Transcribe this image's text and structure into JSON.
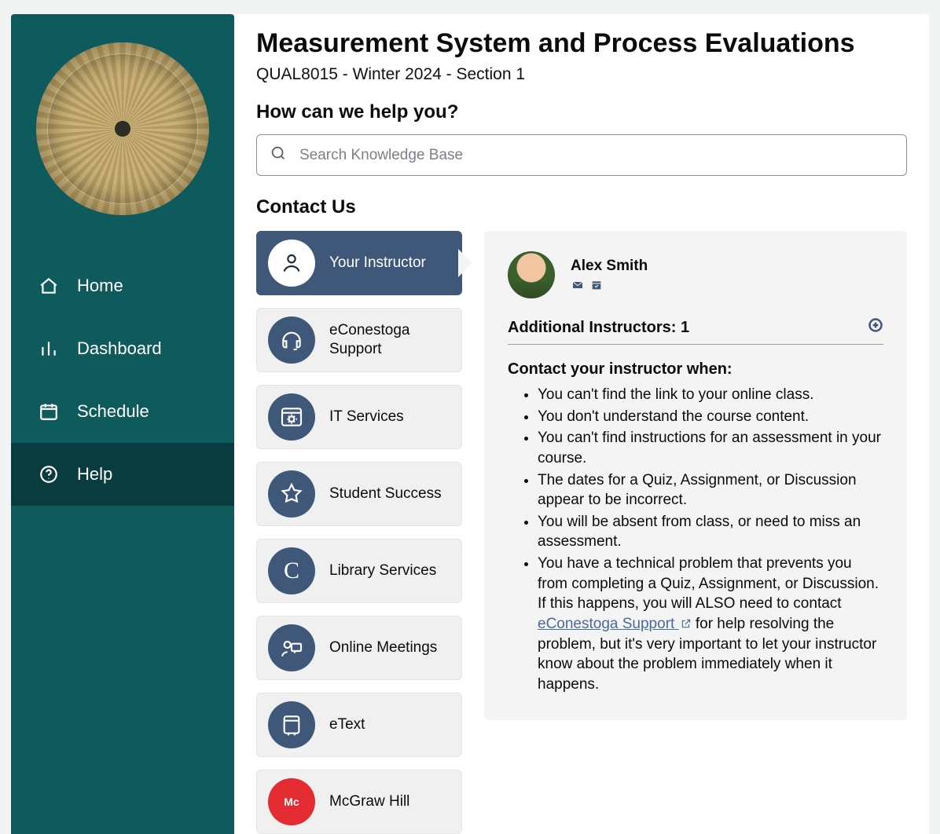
{
  "sidebar": {
    "items": [
      {
        "label": "Home"
      },
      {
        "label": "Dashboard"
      },
      {
        "label": "Schedule"
      },
      {
        "label": "Help"
      }
    ]
  },
  "page": {
    "title": "Measurement System and Process Evaluations",
    "subtitle": "QUAL8015 - Winter 2024 - Section 1",
    "help_heading": "How can we help you?",
    "search_placeholder": "Search Knowledge Base",
    "contact_heading": "Contact Us"
  },
  "contact_options": [
    {
      "label": "Your Instructor"
    },
    {
      "label": "eConestoga Support"
    },
    {
      "label": "IT Services"
    },
    {
      "label": "Student Success"
    },
    {
      "label": "Library Services"
    },
    {
      "label": "Online Meetings"
    },
    {
      "label": "eText"
    },
    {
      "label": "McGraw Hill"
    }
  ],
  "panel": {
    "instructor_name": "Alex Smith",
    "additional_label": "Additional Instructors: 1",
    "when_heading": "Contact your instructor when:",
    "bullets": {
      "b0": "You can't find the link to your online class.",
      "b1": "You don't understand the course content.",
      "b2": "You can't find instructions for an assessment in your course.",
      "b3": "The dates for a Quiz, Assignment, or Discussion appear to be incorrect.",
      "b4": "You will be absent from class, or need to miss an assessment.",
      "b5a": "You have a technical problem that prevents you from completing a Quiz, Assignment, or Discussion. If this happens, you will ALSO need to contact ",
      "b5_link": "eConestoga Support ",
      "b5b": " for help resolving the problem, but it's very important to let your instructor know about the problem immediately when it happens."
    }
  },
  "mcgraw_badge": "Mc"
}
